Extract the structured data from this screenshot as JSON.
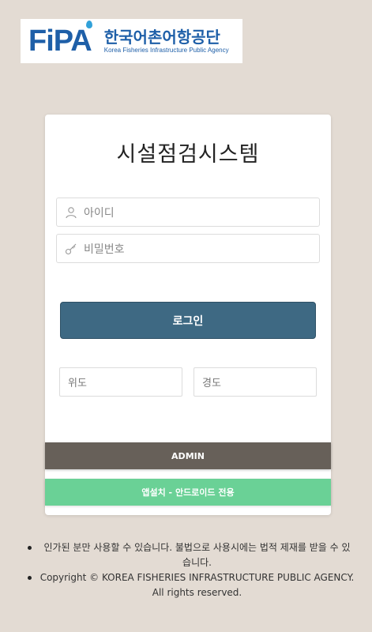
{
  "logo": {
    "mark": "FiPA",
    "korean_name": "한국어촌어항공단",
    "english_name": "Korea Fisheries Infrastructure Public Agency",
    "brand_color": "#1e5fa8"
  },
  "login_card": {
    "title": "시설점검시스템",
    "username": {
      "placeholder": "아이디",
      "icon": "user-icon"
    },
    "password": {
      "placeholder": "비밀번호",
      "icon": "key-icon"
    },
    "login_button": "로그인",
    "latitude_placeholder": "위도",
    "longitude_placeholder": "경도",
    "admin_button": "ADMIN",
    "app_install_button": "앱설치 - 안드로이드 전용"
  },
  "colors": {
    "background": "#e3dbd3",
    "login_button": "#3e6983",
    "admin_button": "#676059",
    "app_button": "#6ad196"
  },
  "footer": {
    "notice": "인가된 분만 사용할 수 있습니다. 불법으로 사용시에는 법적 제재를 받을 수 있습니다.",
    "copyright": "Copyright © KOREA FISHERIES INFRASTRUCTURE PUBLIC AGENCY. All rights reserved."
  }
}
